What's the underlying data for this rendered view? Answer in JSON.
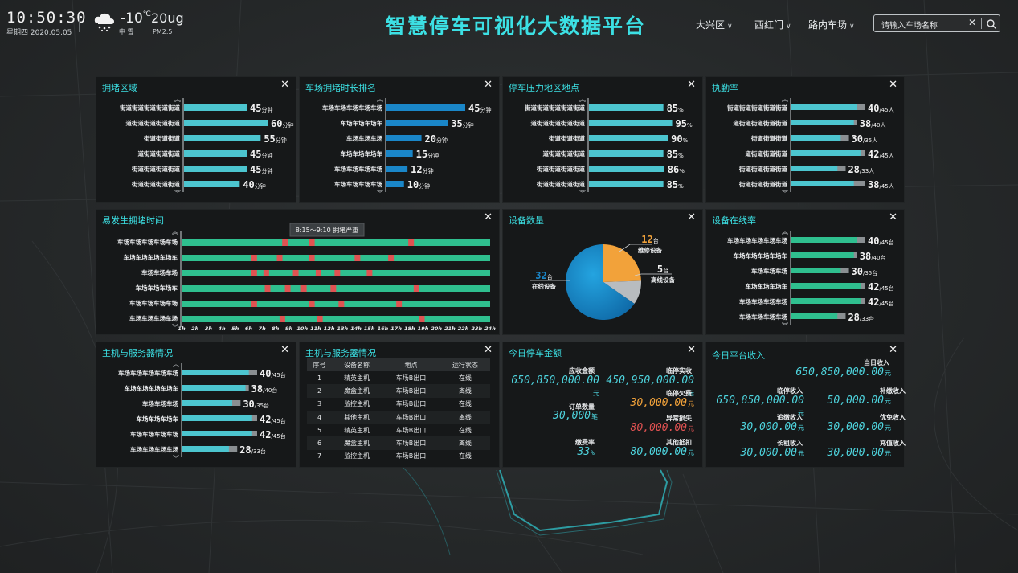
{
  "header": {
    "time": "10:50:30",
    "date": "星期四 2020.05.05",
    "temp": "-10",
    "temp_unit": "℃",
    "weather": "中 雪",
    "pm_value": "20ug",
    "pm_label": "PM2.5",
    "title": "智慧停车可视化大数据平台",
    "dropdowns": [
      "大兴区",
      "西红门",
      "路内车场"
    ],
    "search_placeholder": "请输入车场名称",
    "search_clear": "✕",
    "close_symbol": "✕",
    "scroll_up": "︽",
    "scroll_down": "︾"
  },
  "colors": {
    "accent": "#3ce0e4",
    "bar": "#4cc5cf",
    "blue": "#1a86c8",
    "green": "#2fbf8f",
    "red": "#e05252",
    "orange": "#f2a23a",
    "gray": "#8a8f92"
  },
  "panel_congestion_area": {
    "title": "拥堵区域",
    "chart_data": {
      "type": "bar",
      "orientation": "horizontal",
      "unit": "分钟",
      "categories": [
        "街道街道街道街道街道",
        "道街道街道街道街道",
        "街道街道街道",
        "道街道街道街道",
        "街道街道街道街道",
        "街道街道街道街道"
      ],
      "values": [
        45,
        60,
        55,
        45,
        45,
        40
      ],
      "xlim": [
        0,
        60
      ]
    }
  },
  "panel_duration_rank": {
    "title": "车场拥堵时长排名",
    "chart_data": {
      "type": "bar",
      "orientation": "horizontal",
      "unit": "分钟",
      "categories": [
        "车场车场车场车场车场",
        "车场车场车场车",
        "车场车场车场",
        "车场车场车场车",
        "车场车场车场车场",
        "车场车场车场车场"
      ],
      "values": [
        45,
        35,
        20,
        15,
        12,
        10
      ],
      "xlim": [
        0,
        45
      ]
    }
  },
  "panel_pressure": {
    "title": "停车压力地区地点",
    "chart_data": {
      "type": "bar",
      "orientation": "horizontal",
      "unit": "%",
      "categories": [
        "街道街道街道街道街道",
        "道街道街道街道街道",
        "街道街道街道",
        "道街道街道街道",
        "街道街道街道街道",
        "街道街道街道街道"
      ],
      "values": [
        85,
        95,
        90,
        85,
        86,
        85
      ],
      "xlim": [
        0,
        100
      ]
    }
  },
  "panel_duty_rate": {
    "title": "执勤率",
    "chart_data": {
      "type": "bar",
      "orientation": "horizontal",
      "unit": "人",
      "categories": [
        "街道街道街道街道街道",
        "道街道街道街道街道",
        "街道街道街道",
        "道街道街道街道",
        "街道街道街道街道",
        "街道街道街道街道"
      ],
      "values": [
        40,
        38,
        30,
        42,
        28,
        38
      ],
      "totals": [
        45,
        40,
        35,
        45,
        33,
        45
      ]
    }
  },
  "panel_congestion_time": {
    "title": "易发生拥堵时间",
    "tooltip": "8:15～9:10 拥堵严重",
    "chart_data": {
      "type": "bar",
      "orientation": "horizontal",
      "subtype": "timeline",
      "categories": [
        "车场车场车场车场车场",
        "车场车场车场车场车",
        "车场车场车场",
        "车场车场车场车",
        "车场车场车场车场",
        "车场车场车场车场"
      ],
      "x_ticks": [
        "1h",
        "2h",
        "3h",
        "4h",
        "5h",
        "6h",
        "7h",
        "8h",
        "9h",
        "10h",
        "11h",
        "12h",
        "13h",
        "14h",
        "15h",
        "16h",
        "17h",
        "18h",
        "19h",
        "20h",
        "21h",
        "22h",
        "23h",
        "24h"
      ],
      "xlim": [
        1,
        24
      ],
      "congestion_hours": [
        [
          8.5,
          10.5,
          17.9
        ],
        [
          6.2,
          8.1,
          10.5,
          13.9,
          16.4
        ],
        [
          6.2,
          7.1,
          9.3,
          11,
          12.4,
          14.8
        ],
        [
          7.2,
          8.7,
          9.9,
          12.1,
          18.3
        ],
        [
          6.2,
          10.5,
          12.7,
          17
        ],
        [
          8.3,
          11.1,
          18.7
        ]
      ]
    }
  },
  "panel_device_count": {
    "title": "设备数量",
    "chart_data": {
      "type": "pie",
      "unit": "台",
      "slices": [
        {
          "label": "在线设备",
          "value": 32
        },
        {
          "label": "维修设备",
          "value": 12
        },
        {
          "label": "离线设备",
          "value": 5
        }
      ]
    }
  },
  "panel_device_online": {
    "title": "设备在线率",
    "chart_data": {
      "type": "bar",
      "orientation": "horizontal",
      "unit": "台",
      "categories": [
        "车场车场车场车场车场",
        "车场车场车场车场车",
        "车场车场车场",
        "车场车场车场车",
        "车场车场车场车场",
        "车场车场车场车场"
      ],
      "values": [
        40,
        38,
        30,
        42,
        42,
        28
      ],
      "totals": [
        45,
        40,
        35,
        45,
        45,
        33
      ]
    }
  },
  "panel_host_server": {
    "title": "主机与服务器情况",
    "chart_data": {
      "type": "bar",
      "orientation": "horizontal",
      "unit": "台",
      "categories": [
        "车场车场车场车场车场",
        "车场车场车场车场车",
        "车场车场车场",
        "车场车场车场车",
        "车场车场车场车场",
        "车场车场车场车场"
      ],
      "values": [
        40,
        38,
        30,
        42,
        42,
        28
      ],
      "totals": [
        45,
        40,
        35,
        45,
        45,
        33
      ]
    }
  },
  "panel_host_table": {
    "title": "主机与服务器情况",
    "columns": [
      "序号",
      "设备名称",
      "地点",
      "运行状态"
    ],
    "rows": [
      [
        "1",
        "精英主机",
        "车场B出口",
        "在线"
      ],
      [
        "2",
        "魔盒主机",
        "车场B出口",
        "离线"
      ],
      [
        "3",
        "监控主机",
        "车场B出口",
        "在线"
      ],
      [
        "4",
        "其他主机",
        "车场B出口",
        "离线"
      ],
      [
        "5",
        "精英主机",
        "车场B出口",
        "在线"
      ],
      [
        "6",
        "魔盒主机",
        "车场B出口",
        "离线"
      ],
      [
        "7",
        "监控主机",
        "车场B出口",
        "在线"
      ]
    ]
  },
  "panel_today_amount": {
    "title": "今日停车金额",
    "receivable_label": "应收金额",
    "receivable": "650,850,000.00",
    "receivable_unit": "元",
    "paid_label": "临停实收",
    "paid": "450,950,000.00",
    "paid_unit": "元",
    "owed_label": "临停欠费",
    "owed": "30,000.00",
    "owed_unit": "元",
    "orders_label": "订单数量",
    "orders": "30,000",
    "orders_unit": "笔",
    "loss_label": "异常损失",
    "loss": "80,000.00",
    "loss_unit": "元",
    "rate_label": "缴费率",
    "rate": "33",
    "rate_unit": "%",
    "other_label": "其他抵扣",
    "other": "80,000.00",
    "other_unit": "元"
  },
  "panel_platform_income": {
    "title": "今日平台收入",
    "total_label": "当日收入",
    "total": "650,850,000.00",
    "total_unit": "元",
    "items": [
      {
        "label": "临停收入",
        "value": "650,850,000.00",
        "unit": "元"
      },
      {
        "label": "补缴收入",
        "value": "50,000.00",
        "unit": "元"
      },
      {
        "label": "追缴收入",
        "value": "30,000.00",
        "unit": "元"
      },
      {
        "label": "优免收入",
        "value": "30,000.00",
        "unit": "元"
      },
      {
        "label": "长租收入",
        "value": "30,000.00",
        "unit": "元"
      },
      {
        "label": "充值收入",
        "value": "30,000.00",
        "unit": "元"
      }
    ]
  }
}
